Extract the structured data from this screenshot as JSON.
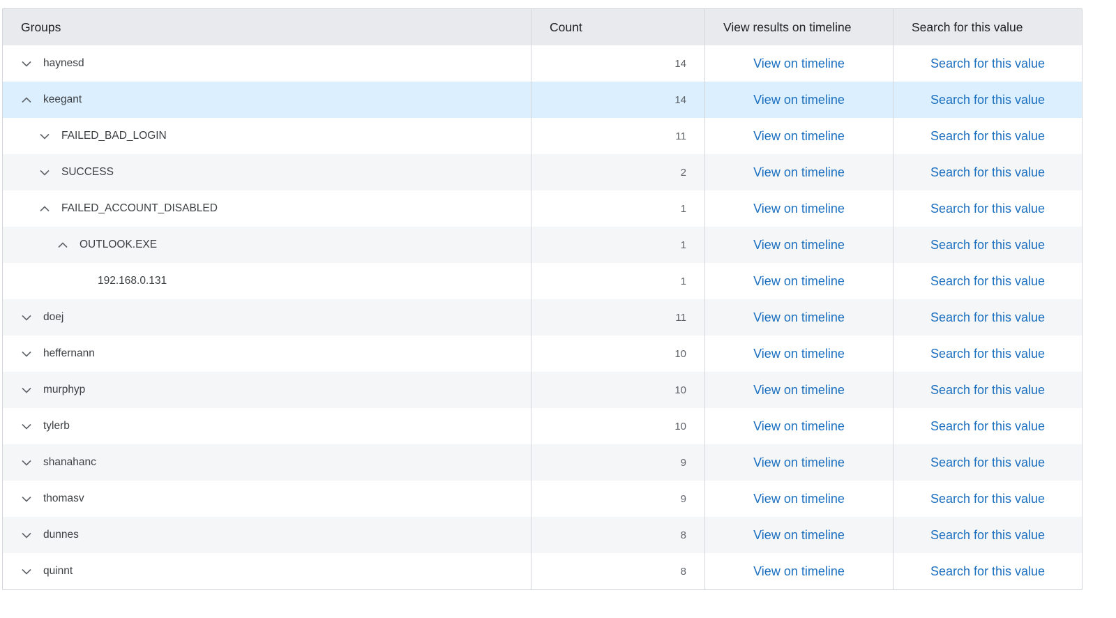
{
  "headers": {
    "groups": "Groups",
    "count": "Count",
    "view": "View results on timeline",
    "search": "Search for this value"
  },
  "link_labels": {
    "view": "View on timeline",
    "search": "Search for this value"
  },
  "rows": [
    {
      "label": "haynesd",
      "count": "14",
      "level": 0,
      "toggle": "chevron-down-icon"
    },
    {
      "label": "keegant",
      "count": "14",
      "level": 0,
      "toggle": "chevron-up-icon",
      "selected": true
    },
    {
      "label": "FAILED_BAD_LOGIN",
      "count": "11",
      "level": 1,
      "toggle": "chevron-down-icon"
    },
    {
      "label": "SUCCESS",
      "count": "2",
      "level": 1,
      "toggle": "chevron-down-icon"
    },
    {
      "label": "FAILED_ACCOUNT_DISABLED",
      "count": "1",
      "level": 1,
      "toggle": "chevron-up-icon"
    },
    {
      "label": "OUTLOOK.EXE",
      "count": "1",
      "level": 2,
      "toggle": "chevron-up-icon"
    },
    {
      "label": "192.168.0.131",
      "count": "1",
      "level": 3,
      "toggle": "none"
    },
    {
      "label": "doej",
      "count": "11",
      "level": 0,
      "toggle": "chevron-down-icon"
    },
    {
      "label": "heffernann",
      "count": "10",
      "level": 0,
      "toggle": "chevron-down-icon"
    },
    {
      "label": "murphyp",
      "count": "10",
      "level": 0,
      "toggle": "chevron-down-icon"
    },
    {
      "label": "tylerb",
      "count": "10",
      "level": 0,
      "toggle": "chevron-down-icon"
    },
    {
      "label": "shanahanc",
      "count": "9",
      "level": 0,
      "toggle": "chevron-down-icon"
    },
    {
      "label": "thomasv",
      "count": "9",
      "level": 0,
      "toggle": "chevron-down-icon"
    },
    {
      "label": "dunnes",
      "count": "8",
      "level": 0,
      "toggle": "chevron-down-icon"
    },
    {
      "label": "quinnt",
      "count": "8",
      "level": 0,
      "toggle": "chevron-down-icon"
    }
  ],
  "colors": {
    "link": "#1a6fbf",
    "header_bg": "#e8eaed",
    "selected_bg": "#dcefff",
    "stripe_bg": "#f5f6f8"
  }
}
